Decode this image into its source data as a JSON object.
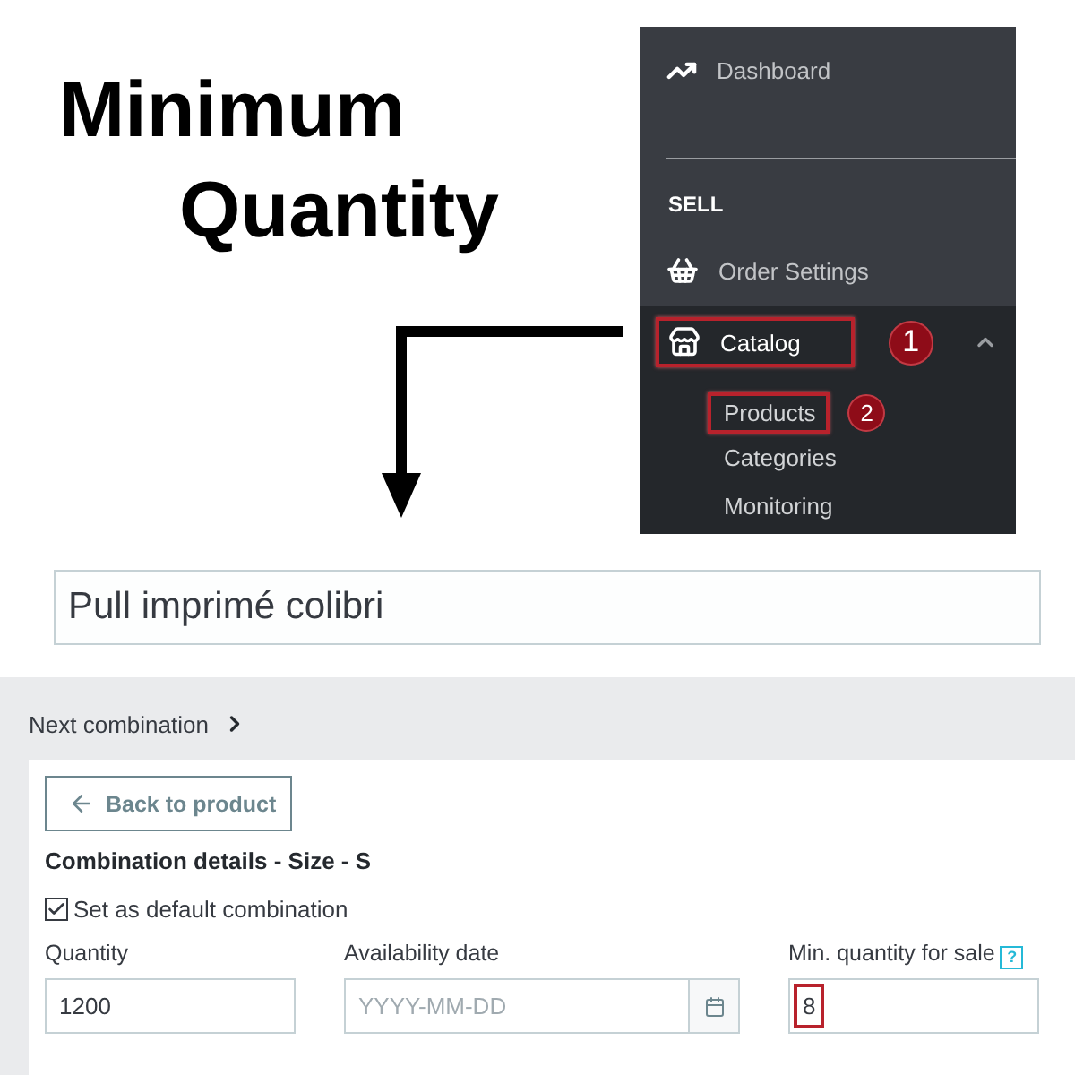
{
  "heading": {
    "lines": [
      "Minimum",
      "Quantity"
    ]
  },
  "sidebar": {
    "top_items": [
      {
        "label": "Dashboard"
      }
    ],
    "section_title": "SELL",
    "items": [
      {
        "label": "Order Settings",
        "expanded": false,
        "highlighted": false
      },
      {
        "label": "Catalog",
        "expanded": true,
        "highlighted": true,
        "badge": "1",
        "children": [
          {
            "label": "Products",
            "highlighted": true,
            "badge": "2"
          },
          {
            "label": "Categories",
            "highlighted": false
          },
          {
            "label": "Monitoring",
            "highlighted": false
          }
        ]
      }
    ]
  },
  "product_name": {
    "value": "Pull imprimé colibri"
  },
  "combination": {
    "next_link": "Next combination",
    "back_button": "Back to product",
    "title": "Combination details - Size - S",
    "default_checkbox": {
      "label": "Set as default combination",
      "checked": true
    },
    "fields": [
      {
        "kind": "text",
        "label": "Quantity",
        "value": "1200",
        "highlighted": false
      },
      {
        "kind": "date",
        "label": "Availability date",
        "placeholder": "YYYY-MM-DD",
        "highlighted": false
      },
      {
        "kind": "text",
        "label": "Min. quantity for sale",
        "help": "?",
        "value": "8",
        "highlighted": true
      }
    ]
  }
}
